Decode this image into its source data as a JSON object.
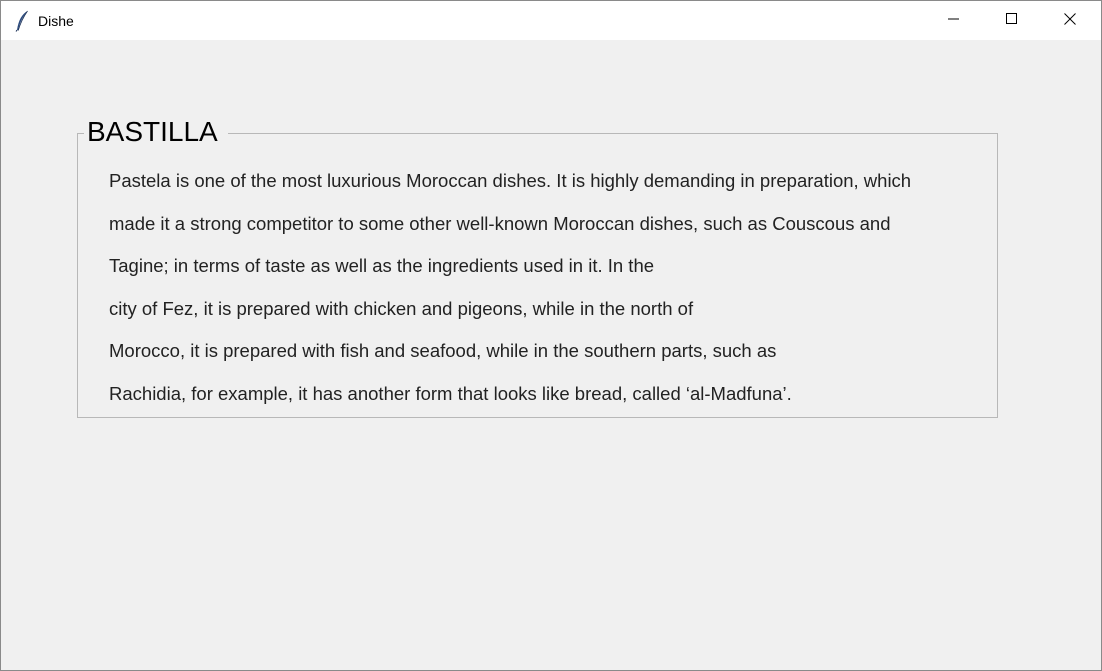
{
  "window": {
    "title": "Dishe",
    "icon": "feather-icon",
    "controls": {
      "minimize": "minimize-icon",
      "maximize": "maximize-icon",
      "close": "close-icon"
    }
  },
  "dish": {
    "name": "BASTILLA",
    "description_lines": [
      "Pastela is one of the most luxurious Moroccan dishes. It is highly demanding in preparation, which",
      "made it a strong competitor to some other well-known Moroccan dishes, such as Couscous and",
      "Tagine; in terms of taste as well as the ingredients used in it. In the",
      "city of Fez, it is prepared with chicken and pigeons, while in the north of",
      "Morocco, it is prepared with fish and seafood, while in the southern parts, such as",
      "Rachidia, for example, it has another form that looks like bread, called ‘al-Madfuna’."
    ]
  },
  "colors": {
    "background": "#f0f0f0",
    "titlebar": "#ffffff",
    "frame_border": "#b8b8b8",
    "text": "#222222"
  }
}
